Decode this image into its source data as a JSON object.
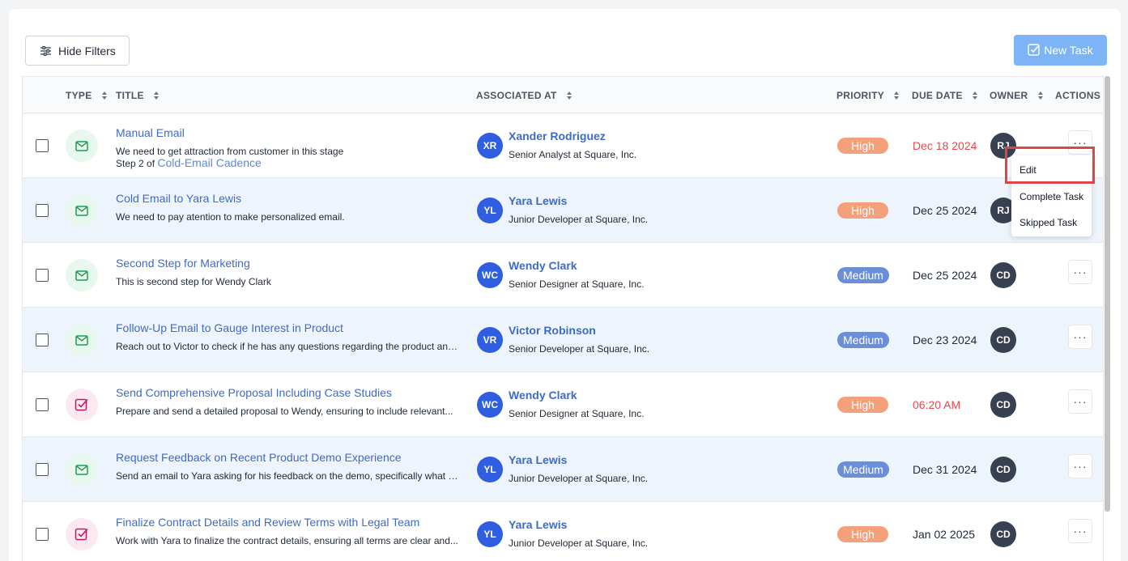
{
  "toolbar": {
    "hide_filters_label": "Hide Filters",
    "new_task_label": "New Task"
  },
  "table": {
    "headers": {
      "type": "TYPE",
      "title": "TITLE",
      "associated": "ASSOCIATED AT",
      "priority": "PRIORITY",
      "due": "DUE DATE",
      "owner": "OWNER",
      "actions": "ACTIONS"
    },
    "rows": [
      {
        "type": "email",
        "title": "Manual Email",
        "description": "We need to get attraction from customer in this stage",
        "step_prefix": "Step 2 of",
        "step_link": "Cold-Email Cadence",
        "assoc_initials": "XR",
        "assoc_name": "Xander Rodriguez",
        "assoc_role": "Senior Analyst at Square, Inc.",
        "priority": "High",
        "due": "Dec 18 2024",
        "due_overdue": true,
        "owner": "RJ",
        "actions": "···"
      },
      {
        "type": "email",
        "title": "Cold Email to Yara Lewis",
        "description": "We need to pay atention to make personalized email.",
        "assoc_initials": "YL",
        "assoc_name": "Yara Lewis",
        "assoc_role": "Junior Developer at Square, Inc.",
        "priority": "High",
        "due": "Dec 25 2024",
        "due_overdue": false,
        "owner": "RJ",
        "actions": "···"
      },
      {
        "type": "email",
        "title": "Second Step for Marketing",
        "description": "This is second step for Wendy Clark",
        "assoc_initials": "WC",
        "assoc_name": "Wendy Clark",
        "assoc_role": "Senior Designer at Square, Inc.",
        "priority": "Medium",
        "due": "Dec 25 2024",
        "due_overdue": false,
        "owner": "CD",
        "actions": "···"
      },
      {
        "type": "email",
        "title": "Follow-Up Email to Gauge Interest in Product",
        "description": "Reach out to Victor to check if he has any questions regarding the product and...",
        "assoc_initials": "VR",
        "assoc_name": "Victor Robinson",
        "assoc_role": "Senior Developer at Square, Inc.",
        "priority": "Medium",
        "due": "Dec 23 2024",
        "due_overdue": false,
        "owner": "CD",
        "actions": "···"
      },
      {
        "type": "task",
        "title": "Send Comprehensive Proposal Including Case Studies",
        "description": "Prepare and send a detailed proposal to Wendy, ensuring to include relevant...",
        "assoc_initials": "WC",
        "assoc_name": "Wendy Clark",
        "assoc_role": "Senior Designer at Square, Inc.",
        "priority": "High",
        "due": "06:20 AM",
        "due_overdue": true,
        "owner": "CD",
        "actions": "···"
      },
      {
        "type": "email",
        "title": "Request Feedback on Recent Product Demo Experience",
        "description": "Send an email to Yara asking for his feedback on the demo, specifically what h...",
        "assoc_initials": "YL",
        "assoc_name": "Yara Lewis",
        "assoc_role": "Junior Developer at Square, Inc.",
        "priority": "Medium",
        "due": "Dec 31 2024",
        "due_overdue": false,
        "owner": "CD",
        "actions": "···"
      },
      {
        "type": "task",
        "title": "Finalize Contract Details and Review Terms with Legal Team",
        "description": "Work with Yara to finalize the contract details, ensuring all terms are clear and...",
        "assoc_initials": "YL",
        "assoc_name": "Yara Lewis",
        "assoc_role": "Junior Developer at Square, Inc.",
        "priority": "High",
        "due": "Jan 02 2025",
        "due_overdue": false,
        "owner": "CD",
        "actions": "···"
      }
    ]
  },
  "action_menu": {
    "items": [
      "Edit",
      "Complete Task",
      "Skipped Task"
    ]
  },
  "colors": {
    "accent": "#7db4f5",
    "link": "#3e6bc4",
    "high": "#f4a07a",
    "medium": "#6b8fd6",
    "overdue": "#e5484d",
    "highlight": "#e04545"
  }
}
